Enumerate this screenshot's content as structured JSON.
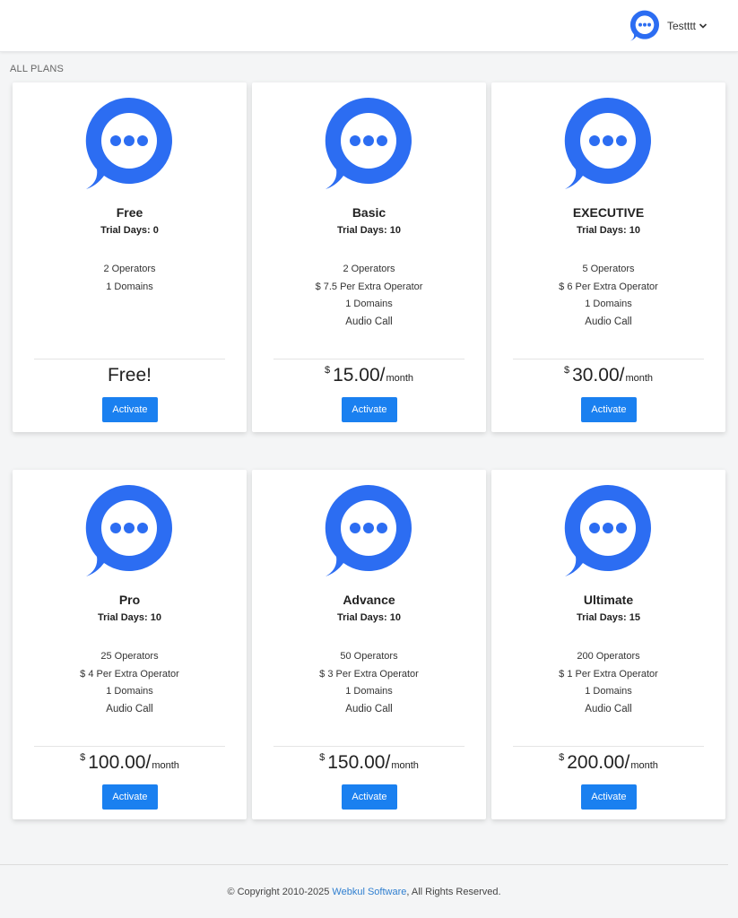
{
  "header": {
    "username": "Testttt",
    "avatar_icon": "chat-bubble-icon",
    "dropdown_icon": "chevron-down-icon"
  },
  "section_label": "ALL PLANS",
  "brand_color": "#2c6df2",
  "button_color": "#1a80f0",
  "plans": [
    {
      "name": "Free",
      "trial": "Trial Days: 0",
      "features": [
        "2 Operators",
        "1 Domains"
      ],
      "price_free": "Free!",
      "button": "Activate"
    },
    {
      "name": "Basic",
      "trial": "Trial Days: 10",
      "features": [
        "2 Operators",
        "$ 7.5 Per Extra Operator",
        "1 Domains",
        "Audio Call"
      ],
      "currency": "$",
      "amount": "15.00/",
      "period": "month",
      "button": "Activate"
    },
    {
      "name": "EXECUTIVE",
      "trial": "Trial Days: 10",
      "features": [
        "5 Operators",
        "$ 6 Per Extra Operator",
        "1 Domains",
        "Audio Call"
      ],
      "currency": "$",
      "amount": "30.00/",
      "period": "month",
      "button": "Activate"
    },
    {
      "name": "Pro",
      "trial": "Trial Days: 10",
      "features": [
        "25 Operators",
        "$ 4 Per Extra Operator",
        "1 Domains",
        "Audio Call"
      ],
      "currency": "$",
      "amount": "100.00/",
      "period": "month",
      "button": "Activate"
    },
    {
      "name": "Advance",
      "trial": "Trial Days: 10",
      "features": [
        "50 Operators",
        "$ 3 Per Extra Operator",
        "1 Domains",
        "Audio Call"
      ],
      "currency": "$",
      "amount": "150.00/",
      "period": "month",
      "button": "Activate"
    },
    {
      "name": "Ultimate",
      "trial": "Trial Days: 15",
      "features": [
        "200 Operators",
        "$ 1 Per Extra Operator",
        "1 Domains",
        "Audio Call"
      ],
      "currency": "$",
      "amount": "200.00/",
      "period": "month",
      "button": "Activate"
    }
  ],
  "footer": {
    "prefix": "© Copyright 2010-2025 ",
    "link": "Webkul Software",
    "suffix": ", All Rights Reserved."
  }
}
